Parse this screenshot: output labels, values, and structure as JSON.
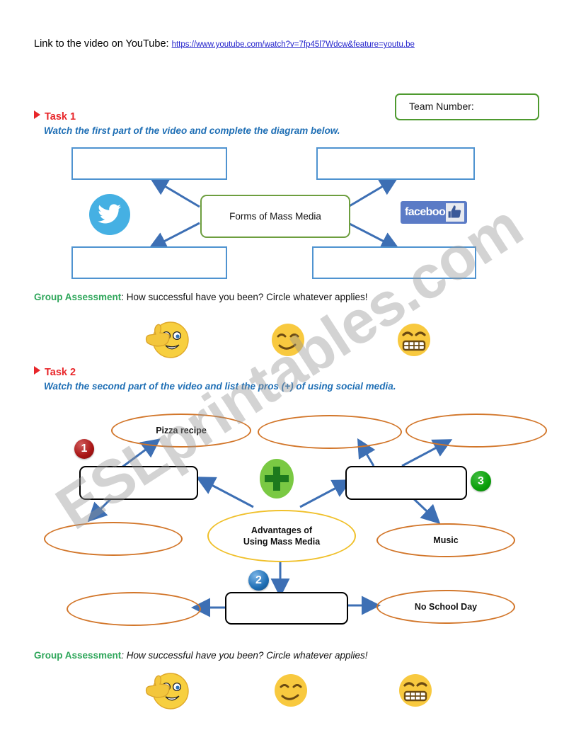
{
  "header": {
    "link_label": "Link to the video on YouTube:",
    "url": "https://www.youtube.com/watch?v=7fp45l7Wdcw&feature=youtu.be"
  },
  "team": {
    "label": "Team Number:"
  },
  "task1": {
    "title": "Task 1",
    "instruction": "Watch the first part of the video and complete the diagram below.",
    "center_label": "Forms of Mass Media",
    "answer_boxes": [
      "",
      "",
      "",
      ""
    ],
    "logos": {
      "twitter": "twitter-bird-logo",
      "facebook_word": "facebook"
    },
    "group_assessment": {
      "label": "Group Assessment",
      "rest": ": How successful have you been? Circle whatever applies!"
    },
    "emojis": [
      "thumbs-up-smiley",
      "smirking-face",
      "grinning-face-clenched-teeth"
    ]
  },
  "task2": {
    "title": "Task 2",
    "instruction": "Watch the second part of the video and list the pros (+) of using social media.",
    "center_label_line1": "Advantages of",
    "center_label_line2": "Using Mass Media",
    "plus_symbol": "+",
    "badges": [
      "1",
      "2",
      "3"
    ],
    "ellipses": {
      "top_left": "Pizza recipe",
      "top_mid": "",
      "top_right": "",
      "mid_left": "",
      "mid_right": "Music",
      "bottom_left": "",
      "bottom_right": "No School Day"
    },
    "answer_boxes": [
      "",
      "",
      ""
    ],
    "group_assessment": {
      "label": "Group Assessment",
      "rest": ": How successful have you been? Circle whatever applies!"
    },
    "emojis": [
      "thumbs-up-smiley",
      "smirking-face",
      "grinning-face-clenched-teeth"
    ]
  },
  "watermark": {
    "text": "ESLprintables.com"
  },
  "colors": {
    "task_red": "#e8262a",
    "instruction_blue": "#1f6fb5",
    "assessment_green": "#2ea65a",
    "box_blue": "#4f93d0",
    "box_green": "#6d9e3f",
    "ellipse_orange": "#d2762a",
    "ellipse_yellow": "#f0c02a",
    "arrow_blue": "#3d6fb4",
    "link_blue": "#2222cc"
  }
}
